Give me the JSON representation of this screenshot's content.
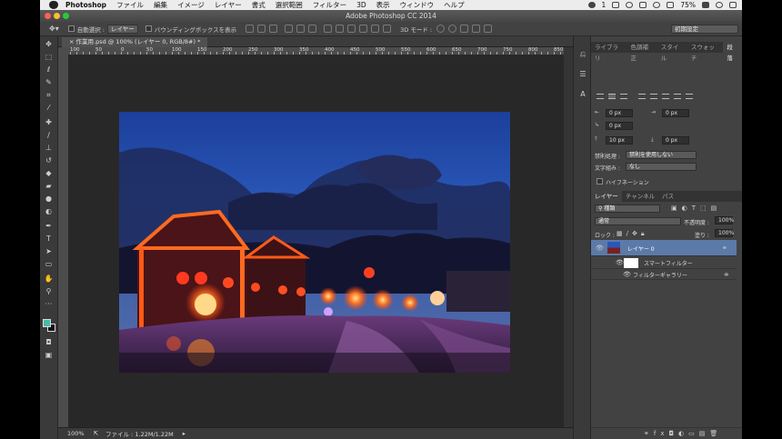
{
  "menubar": {
    "app_name": "Photoshop",
    "items": [
      "ファイル",
      "編集",
      "イメージ",
      "レイヤー",
      "書式",
      "選択範囲",
      "フィルター",
      "3D",
      "表示",
      "ウィンドウ",
      "ヘルプ"
    ],
    "battery": "75%",
    "notification_count": "1"
  },
  "window": {
    "title": "Adobe Photoshop CC 2014"
  },
  "optionsbar": {
    "auto_select_label": "自動選択 :",
    "auto_select_value": "レイヤー",
    "bounding_box_label": "バウンディングボックスを表示",
    "mode_3d_label": "3D モード :",
    "workspace": "初期設定"
  },
  "document": {
    "tab_title": "作業用.psd @ 100% (レイヤー 0, RGB/8#) *",
    "ruler_labels": [
      "100",
      "50",
      "0",
      "50",
      "100",
      "150",
      "200",
      "250",
      "300",
      "350",
      "400",
      "450",
      "500",
      "550",
      "600",
      "650",
      "700",
      "750",
      "800",
      "850"
    ],
    "zoom": "100%",
    "file_info": "ファイル : 1.22M/1.22M"
  },
  "paragraph_panel": {
    "tabs": [
      "ライブラリ",
      "色調補正",
      "スタイル",
      "スウォッチ",
      "段落"
    ],
    "active_tab": "段落",
    "indent_left": "0 px",
    "indent_right": "0 px",
    "indent_first": "0 px",
    "space_before": "10 px",
    "space_after": "0 px",
    "kinsoku_label": "禁則処理 :",
    "kinsoku_value": "禁則を使用しない",
    "mojikumi_label": "文字組み :",
    "mojikumi_value": "なし",
    "hyphenate_label": "ハイフネーション"
  },
  "layers_panel": {
    "tabs": [
      "レイヤー",
      "チャンネル",
      "パス"
    ],
    "active_tab": "レイヤー",
    "filter_kind": "種類",
    "blend_mode": "通常",
    "opacity_label": "不透明度 :",
    "opacity_value": "100%",
    "lock_label": "ロック :",
    "fill_label": "塗り :",
    "fill_value": "100%",
    "layers": [
      {
        "name": "レイヤー 0"
      },
      {
        "name": "スマートフィルター"
      },
      {
        "name": "フィルターギャラリー"
      }
    ]
  },
  "colors": {
    "foreground": "#48b9a8",
    "background": "#111111",
    "selected_layer": "#5c7aa8",
    "traffic_red": "#ff5f56",
    "traffic_yellow": "#ffbd2e",
    "traffic_green": "#27c93f"
  }
}
